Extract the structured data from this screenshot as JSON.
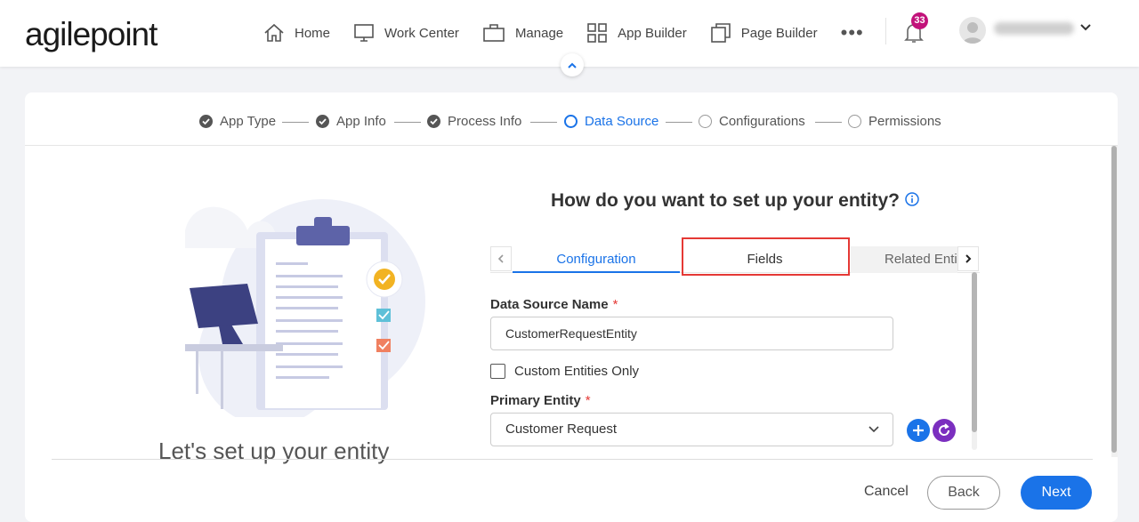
{
  "brand": {
    "logo_text": "agilepoint"
  },
  "nav": {
    "items": [
      {
        "label": "Home",
        "icon": "home-icon"
      },
      {
        "label": "Work Center",
        "icon": "monitor-icon"
      },
      {
        "label": "Manage",
        "icon": "briefcase-icon"
      },
      {
        "label": "App Builder",
        "icon": "grid-icon"
      },
      {
        "label": "Page Builder",
        "icon": "pages-icon"
      }
    ],
    "more": "•••",
    "notification_count": "33"
  },
  "stepper": {
    "steps": [
      {
        "label": "App Type",
        "state": "done"
      },
      {
        "label": "App Info",
        "state": "done"
      },
      {
        "label": "Process Info",
        "state": "done"
      },
      {
        "label": "Data Source",
        "state": "active"
      },
      {
        "label": "Configurations",
        "state": "todo"
      },
      {
        "label": "Permissions",
        "state": "todo"
      }
    ]
  },
  "illustration": {
    "title": "Let's set up your entity"
  },
  "form": {
    "title": "How do you want to set up your entity?",
    "tabs": [
      {
        "label": "Configuration"
      },
      {
        "label": "Fields"
      },
      {
        "label": "Related Enti"
      }
    ],
    "data_source_name": {
      "label": "Data Source Name",
      "required": "*",
      "value": "CustomerRequestEntity"
    },
    "custom_entities_only": {
      "label": "Custom Entities Only"
    },
    "primary_entity": {
      "label": "Primary Entity",
      "required": "*",
      "value": "Customer Request"
    }
  },
  "footer": {
    "cancel": "Cancel",
    "back": "Back",
    "next": "Next"
  },
  "colors": {
    "accent": "#1a73e8",
    "badge": "#c2127a",
    "highlight": "#e53935",
    "refresh": "#7b2fbf"
  }
}
